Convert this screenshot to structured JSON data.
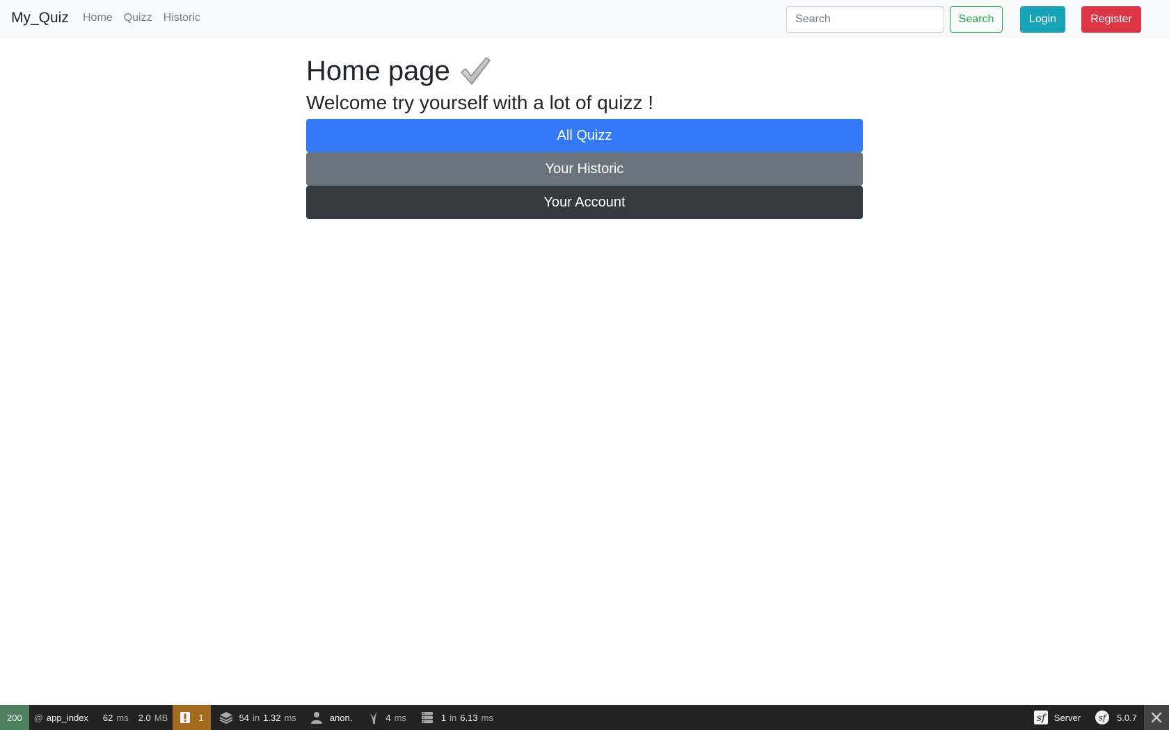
{
  "navbar": {
    "brand": "My_Quiz",
    "links": [
      "Home",
      "Quizz",
      "Historic"
    ],
    "search_placeholder": "Search",
    "search_button": "Search",
    "login_button": "Login",
    "register_button": "Register"
  },
  "main": {
    "title": "Home page",
    "subtitle": "Welcome try yourself with a lot of quizz !",
    "buttons": [
      "All Quizz",
      "Your Historic",
      "Your Account"
    ]
  },
  "toolbar": {
    "status_code": "200",
    "route_prefix": "@",
    "route": "app_index",
    "time_value": "62",
    "time_unit": "ms",
    "memory_value": "2.0",
    "memory_unit": "MB",
    "warnings": "1",
    "cache_calls": "54",
    "cache_in": "in",
    "cache_time": "1.32",
    "cache_unit": "ms",
    "user": "anon.",
    "twig_time": "4",
    "twig_unit": "ms",
    "db_queries": "1",
    "db_in": "in",
    "db_time": "6.13",
    "db_unit": "ms",
    "server_label": "Server",
    "symfony_version": "5.0.7",
    "colors": {
      "status_ok": "#4f805d",
      "warning": "#a46a1f",
      "bar": "#222222"
    }
  },
  "colors": {
    "primary": "#3479f6",
    "secondary": "#6c757d",
    "dark": "#343a40",
    "info": "#17a2b8",
    "danger": "#dc3545",
    "success": "#28a745"
  }
}
